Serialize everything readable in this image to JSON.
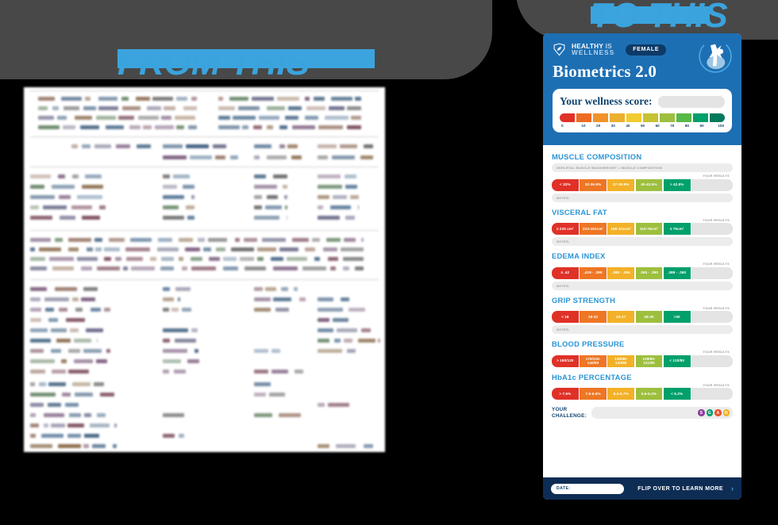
{
  "banners": {
    "from_label": "FROM THIS",
    "to_label": "TO THIS",
    "accent_color": "#3ba4de",
    "backdrop_color": "#484848"
  },
  "document": {
    "description": "blurred-lab-report"
  },
  "card": {
    "brand": {
      "line1_a": "HEALTHY",
      "line1_b": " IS",
      "line2": "WELLNESS",
      "logo_icon": "shield-leaf-icon"
    },
    "gender_badge": "FEMALE",
    "avatar_icon": "female-body-icon",
    "title": "Biometrics 2.0",
    "score": {
      "label": "Your wellness score:",
      "value": "",
      "ticks": [
        "0",
        "10",
        "20",
        "30",
        "40",
        "50",
        "60",
        "70",
        "80",
        "90",
        "100"
      ],
      "colors": [
        "#e03127",
        "#ee6b22",
        "#f0932a",
        "#edb02c",
        "#f2cb2e",
        "#c5c234",
        "#9dbf3e",
        "#56b948",
        "#00a06a",
        "#00795c"
      ]
    },
    "results_header": "YOUR RESULTS",
    "notes_label": "NOTES:",
    "band_colors": [
      "#e03127",
      "#ee7624",
      "#f2b128",
      "#9dbf3e",
      "#00a06a"
    ],
    "metrics": [
      {
        "title": "MUSCLE COMPOSITION",
        "subtitle": "SKELETAL MUSCLE MASS/WEIGHT = MUSCLE COMPOSITION",
        "bands": [
          "< 32%",
          "32-36.9%",
          "37-39.9%",
          "40-42.5%",
          "> 42.5%"
        ],
        "has_notes": true
      },
      {
        "title": "VISCERAL FAT",
        "subtitle": "",
        "bands": [
          "≥ 225 cm²",
          "224-151cm²",
          "150-111cm²",
          "110-76cm²",
          "≤ 75cm²"
        ],
        "has_notes": true
      },
      {
        "title": "EDEMA INDEX",
        "subtitle": "",
        "bands": [
          "≥ .42",
          ".419 - .399",
          ".398 - .394",
          ".393 - .390",
          ".389 - .360"
        ],
        "has_notes": true
      },
      {
        "title": "GRIP STRENGTH",
        "subtitle": "",
        "bands": [
          "< 18",
          "18-22",
          "23-27",
          "28-30",
          ">30"
        ],
        "has_notes": true
      },
      {
        "title": "BLOOD PRESSURE",
        "subtitle": "",
        "bands": [
          "> 180/120",
          "179/119-\n140/90",
          "139/89-\n130/80",
          "129/80-\n121/80",
          "< 120/80"
        ],
        "has_notes": false
      },
      {
        "title": "HbA1c PERCENTAGE",
        "subtitle": "",
        "bands": [
          "> 7.5%",
          "7.5-6.5%",
          "6.4-5.7%",
          "5.6-5.3%",
          "< 5.2%"
        ],
        "has_notes": false
      }
    ],
    "challenge": {
      "label_line1": "YOUR",
      "label_line2": "CHALLENGE:",
      "dots": [
        {
          "letter": "S",
          "color": "#8e3d9e"
        },
        {
          "letter": "G",
          "color": "#00a06a"
        },
        {
          "letter": "A",
          "color": "#e8522a"
        },
        {
          "letter": "N",
          "color": "#f2b128"
        }
      ]
    },
    "footer": {
      "date_label": "DATE:",
      "flip_text": "FLIP OVER TO LEARN MORE",
      "chevron_icon": "chevron-right-icon"
    }
  }
}
